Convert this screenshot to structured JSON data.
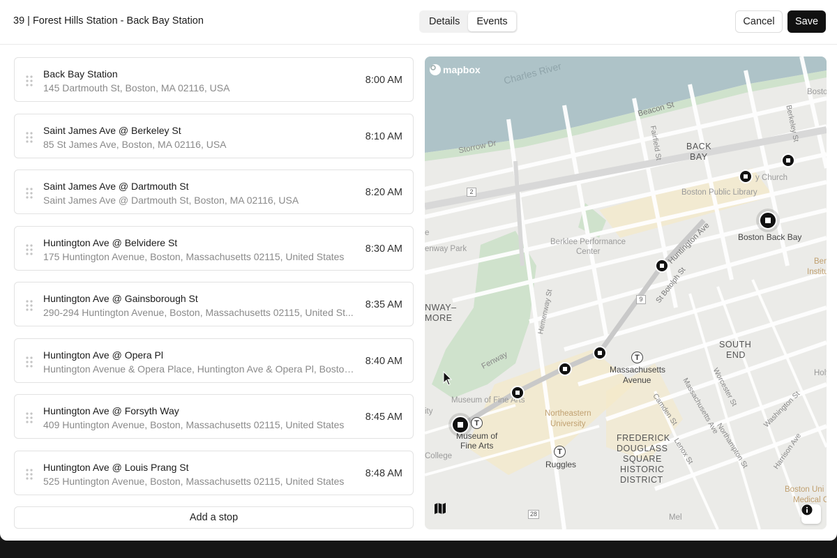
{
  "header": {
    "title": "39 | Forest Hills Station - Back Bay Station",
    "tabs": [
      {
        "label": "Details",
        "active": false
      },
      {
        "label": "Events",
        "active": true
      }
    ],
    "cancel_label": "Cancel",
    "save_label": "Save"
  },
  "stops": [
    {
      "name": "Back Bay Station",
      "address": "145 Dartmouth St, Boston, MA 02116, USA",
      "time": "8:00 AM"
    },
    {
      "name": "Saint James Ave @ Berkeley St",
      "address": "85 St James Ave, Boston, MA 02116, USA",
      "time": "8:10 AM"
    },
    {
      "name": "Saint James Ave @ Dartmouth St",
      "address": "Saint James Ave @ Dartmouth St, Boston, MA 02116, USA",
      "time": "8:20 AM"
    },
    {
      "name": "Huntington Ave @ Belvidere St",
      "address": "175 Huntington Avenue, Boston, Massachusetts 02115, United States",
      "time": "8:30 AM"
    },
    {
      "name": "Huntington Ave @ Gainsborough St",
      "address": "290-294 Huntington Avenue, Boston, Massachusetts 02115, United St...",
      "time": "8:35 AM"
    },
    {
      "name": "Huntington Ave @ Opera Pl",
      "address": "Huntington Avenue & Opera Place, Huntington Ave & Opera Pl, Boston, ...",
      "time": "8:40 AM"
    },
    {
      "name": "Huntington Ave @ Forsyth Way",
      "address": "409 Huntington Avenue, Boston, Massachusetts 02115, United States",
      "time": "8:45 AM"
    },
    {
      "name": "Huntington Ave @ Louis Prang St",
      "address": "525 Huntington Avenue, Boston, Massachusetts 02115, United States",
      "time": "8:48 AM"
    }
  ],
  "add_stop_label": "Add a stop",
  "map": {
    "attribution": "mapbox",
    "labels": {
      "charles_river": "Charles River",
      "beacon_st": "Beacon St",
      "storrow_dr": "Storrow Dr",
      "fairfield_st": "Fairfield St",
      "berkeley_st": "Berkeley St",
      "boston": "Boston",
      "back": "BACK",
      "bay": "BAY",
      "church": "y Church",
      "library": "Boston Public Library",
      "boston_back_bay": "Boston Back Bay",
      "fenway_park": "enway Park",
      "e_label": "e",
      "berklee_1": "Berklee Performance",
      "berklee_2": "Center",
      "huntington_ave": "Huntington Ave",
      "st_botolph": "St Botolph St",
      "benja": "Benja",
      "institute": "Institute",
      "hemenway": "Hemenway St",
      "nway": "NWAY–",
      "more": "MORE",
      "fenway": "Fenway",
      "south": "SOUTH",
      "end": "END",
      "mass_ave_1": "Massachusetts",
      "mass_ave_2": "Avenue",
      "worcester": "Worcester St",
      "holy": "Holy",
      "museum": "Museum of Fine Arts",
      "ity": "ity",
      "northeastern_1": "Northeastern",
      "northeastern_2": "University",
      "camden": "Camden St",
      "mass_ave_st": "Massachusetts Ave",
      "washington": "Washington St",
      "mfa_station_1": "Museum of",
      "mfa_station_2": "Fine Arts",
      "fd1": "FREDERICK",
      "fd2": "DOUGLASS",
      "fd3": "SQUARE",
      "fd4": "HISTORIC",
      "fd5": "DISTRICT",
      "lenox": "Lenox St",
      "northampton": "Northampton St",
      "harrison": "Harrison Ave",
      "college": "College",
      "ruggles": "Ruggles",
      "boston_uni": "Boston Uni",
      "medical": "Medical Ca",
      "route_2": "2",
      "route_9": "9",
      "route_28": "28",
      "mel": "Mel"
    },
    "icons": {
      "map_style": "map-icon",
      "info": "info-icon",
      "transit": "T"
    }
  },
  "colors": {
    "water": "#aec3c8",
    "park": "#cfe2cc",
    "land": "#ebebe8",
    "block": "#f0efe6",
    "road": "#ffffff",
    "highlight": "#f5e9c8",
    "marker": "#111111"
  }
}
